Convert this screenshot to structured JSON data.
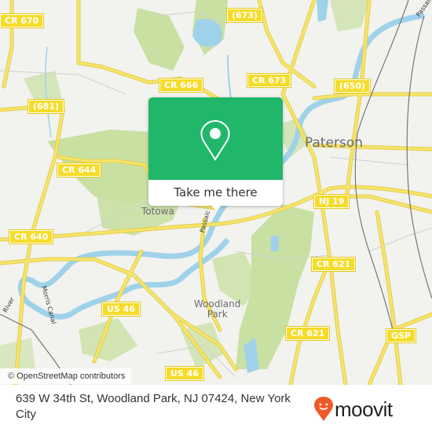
{
  "map": {
    "colors": {
      "background": "#f2f2ee",
      "park": "#c8e0a2",
      "water": "#9fd2ea",
      "road": "#f7e46a",
      "road_outline": "#e3cf4e",
      "minor_road": "#cfcfcf",
      "rail": "#777777"
    },
    "shields": [
      {
        "id": "cr670",
        "label": "CR 670"
      },
      {
        "id": "r673a",
        "label": "(673)"
      },
      {
        "id": "cr666",
        "label": "CR 666"
      },
      {
        "id": "cr673",
        "label": "CR 673"
      },
      {
        "id": "r650",
        "label": "(650)"
      },
      {
        "id": "r681",
        "label": "(681)"
      },
      {
        "id": "cr644",
        "label": "CR 644"
      },
      {
        "id": "nj19",
        "label": "NJ 19"
      },
      {
        "id": "cr640",
        "label": "CR 640"
      },
      {
        "id": "cr621a",
        "label": "CR 621"
      },
      {
        "id": "us46a",
        "label": "US 46"
      },
      {
        "id": "cr621b",
        "label": "CR 621"
      },
      {
        "id": "gsp",
        "label": "GSP"
      },
      {
        "id": "us46b",
        "label": "US 46"
      }
    ],
    "places": {
      "paterson": "Paterson",
      "totowa": "Totowa",
      "woodland_park_line1": "Woodland",
      "woodland_park_line2": "Park"
    },
    "water_labels": {
      "passaic_top": "Passaic",
      "passaic_mid": "Passaic",
      "river": "River",
      "canal": "Morris Canal"
    },
    "attribution": "© OpenStreetMap contributors"
  },
  "popup": {
    "icon": "map-pin-icon",
    "cta_label": "Take me there",
    "accent": "#20b76a"
  },
  "footer": {
    "address": "639 W 34th St, Woodland Park, NJ 07424, New York City",
    "brand_name": "moovit",
    "brand_icon": "moovit-pin-smile-icon",
    "brand_color": "#f05a28"
  }
}
